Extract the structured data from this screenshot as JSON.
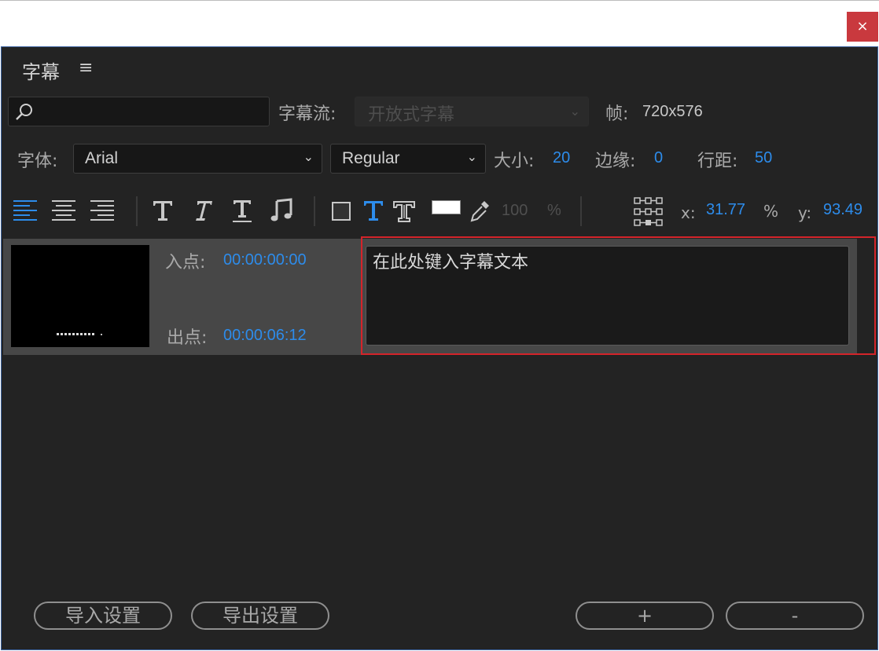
{
  "window": {
    "close_symbol": "×"
  },
  "panel": {
    "title": "字幕",
    "menu_symbol": "≡"
  },
  "search": {
    "value": "",
    "icon": "search-icon"
  },
  "stream": {
    "label": "字幕流:",
    "value": "开放式字幕"
  },
  "frame": {
    "label": "帧:",
    "value": "720x576"
  },
  "font": {
    "label": "字体:",
    "family": "Arial",
    "style": "Regular"
  },
  "size": {
    "label": "大小:",
    "value": "20"
  },
  "edge": {
    "label": "边缘:",
    "value": "0"
  },
  "line_spacing": {
    "label": "行距:",
    "value": "50"
  },
  "opacity": {
    "value": "100",
    "unit": "%"
  },
  "position": {
    "x_label": "x:",
    "x_value": "31.77",
    "unit": "%",
    "y_label": "y:",
    "y_value": "93.49"
  },
  "caption": {
    "in_label": "入点:",
    "in_value": "00:00:00:00",
    "out_label": "出点:",
    "out_value": "00:00:06:12",
    "text": "在此处键入字幕文本"
  },
  "buttons": {
    "import": "导入设置",
    "export": "导出设置",
    "add": "+",
    "remove": "-"
  },
  "colors": {
    "accent": "#2d8ceb",
    "panel_bg": "#232323",
    "selection_border": "#d4242a",
    "close_bg": "#c9393e"
  }
}
